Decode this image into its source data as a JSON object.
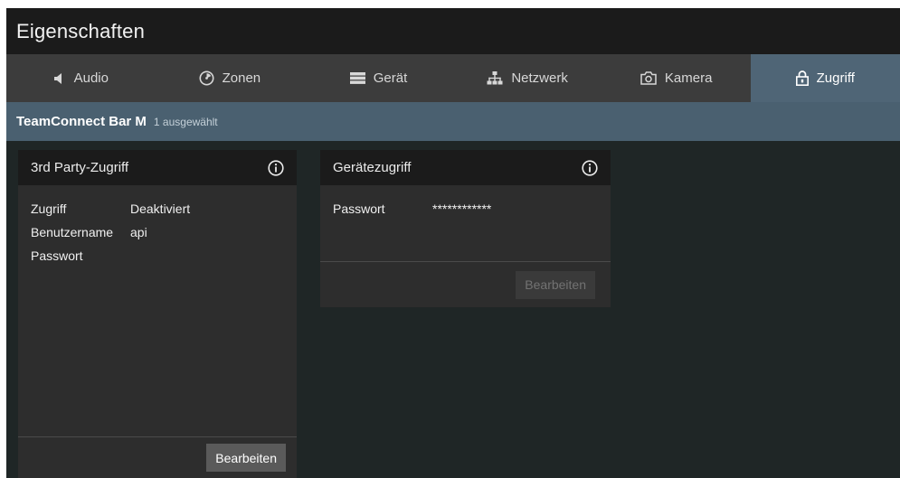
{
  "window": {
    "title": "Eigenschaften"
  },
  "tabs": [
    {
      "label": "Audio",
      "icon": "speaker-icon"
    },
    {
      "label": "Zonen",
      "icon": "zones-icon"
    },
    {
      "label": "Gerät",
      "icon": "device-icon"
    },
    {
      "label": "Netzwerk",
      "icon": "network-icon"
    },
    {
      "label": "Kamera",
      "icon": "camera-icon"
    },
    {
      "label": "Zugriff",
      "icon": "lock-icon",
      "active": true
    }
  ],
  "device": {
    "name": "TeamConnect Bar M",
    "selection": "1 ausgewählt"
  },
  "third_party_card": {
    "title": "3rd Party-Zugriff",
    "rows": [
      {
        "key": "Zugriff",
        "value": "Deaktiviert"
      },
      {
        "key": "Benutzername",
        "value": "api"
      },
      {
        "key": "Passwort",
        "value": ""
      }
    ],
    "button": "Bearbeiten"
  },
  "device_access_card": {
    "title": "Gerätezugriff",
    "rows": [
      {
        "key": "Passwort",
        "value": "************"
      }
    ],
    "button": "Bearbeiten",
    "button_disabled": true
  },
  "colors": {
    "title_bg": "#1b1b1b",
    "tabs_bg": "#3c3c3c",
    "active_tab": "#4f6576",
    "device_band": "#4a6070",
    "content_bg": "#1f2626",
    "card_bg": "#2d2d2d"
  }
}
